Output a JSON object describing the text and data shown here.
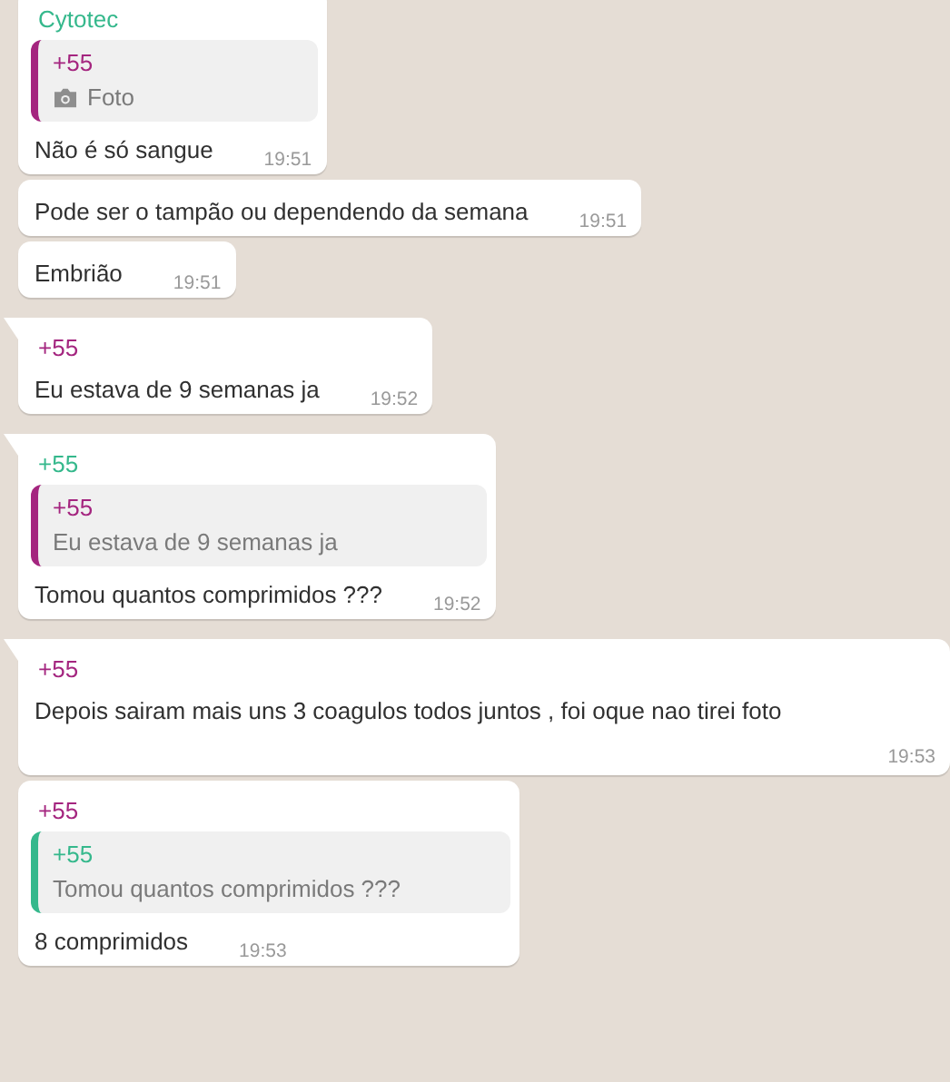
{
  "messages": [
    {
      "tail": false,
      "kind": "inline",
      "sender": {
        "text": "Cytotec",
        "color": "#35b88c"
      },
      "quote": {
        "sender": "+55",
        "color": "#a4257f",
        "kind": "photo",
        "text": "Foto"
      },
      "text": "Não é só sangue",
      "time": "19:51"
    },
    {
      "tail": false,
      "kind": "inline",
      "text": "Pode ser o tampão ou dependendo da semana",
      "time": "19:51"
    },
    {
      "tail": false,
      "kind": "inline",
      "text": "Embrião",
      "time": "19:51"
    },
    {
      "tail": true,
      "kind": "inline",
      "sender": {
        "text": "+55",
        "color": "#a4257f"
      },
      "text": "Eu estava de 9 semanas ja",
      "time": "19:52"
    },
    {
      "tail": true,
      "kind": "inline",
      "sender": {
        "text": "+55",
        "color": "#35b88c"
      },
      "quote": {
        "sender": "+55",
        "color": "#a4257f",
        "text": "Eu estava de 9 semanas ja"
      },
      "text": "Tomou quantos comprimidos ???",
      "time": "19:52"
    },
    {
      "tail": true,
      "kind": "wide",
      "sender": {
        "text": "+55",
        "color": "#a4257f"
      },
      "text": "Depois sairam mais uns 3 coagulos todos juntos  , foi oque nao tirei foto",
      "time": "19:53"
    },
    {
      "tail": false,
      "kind": "inline",
      "sender": {
        "text": "+55",
        "color": "#a4257f"
      },
      "quote": {
        "sender": "+55",
        "color": "#35b88c",
        "text": "Tomou quantos comprimidos ???"
      },
      "text": "8 comprimidos",
      "time": "19:53"
    }
  ]
}
